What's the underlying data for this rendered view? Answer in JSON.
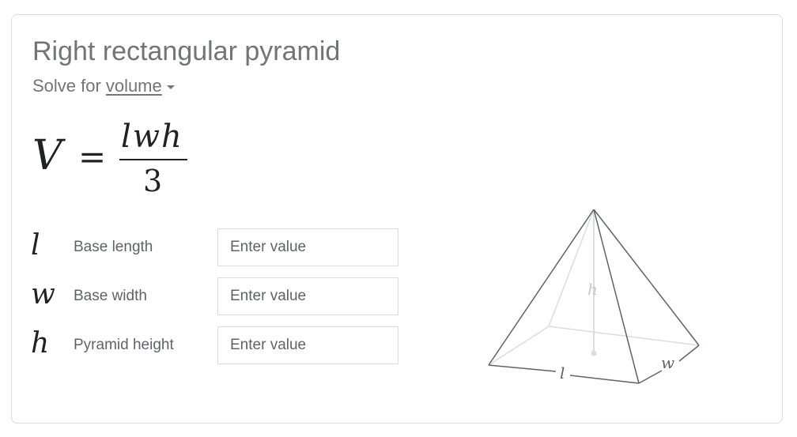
{
  "title": "Right rectangular pyramid",
  "solve_for": {
    "prefix": "Solve for",
    "selected": "volume"
  },
  "formula": {
    "lhs": "V",
    "equals": "=",
    "numerator": "lwh",
    "denominator": "3"
  },
  "variables": [
    {
      "symbol": "l",
      "label": "Base length",
      "placeholder": "Enter value",
      "value": ""
    },
    {
      "symbol": "w",
      "label": "Base width",
      "placeholder": "Enter value",
      "value": ""
    },
    {
      "symbol": "h",
      "label": "Pyramid height",
      "placeholder": "Enter value",
      "value": ""
    }
  ],
  "diagram": {
    "labels": {
      "height": "h",
      "length": "l",
      "width": "w"
    },
    "colors": {
      "edge": "#5f6368",
      "hidden_edge": "#dadce0",
      "hidden_label": "#c7c9cc"
    }
  }
}
